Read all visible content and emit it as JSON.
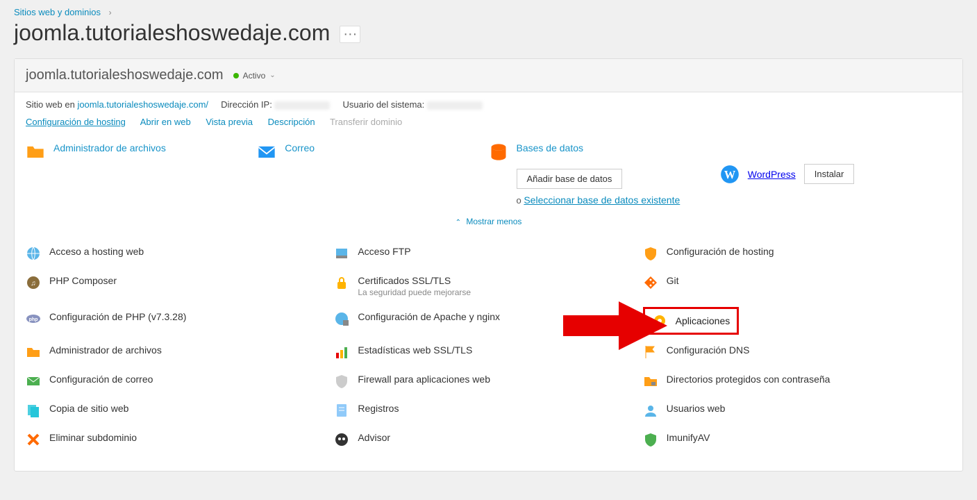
{
  "breadcrumb": {
    "root": "Sitios web y dominios"
  },
  "page_title": "joomla.tutorialeshoswedaje.com",
  "header": {
    "domain": "joomla.tutorialeshoswedaje.com",
    "status": "Activo"
  },
  "info": {
    "site_label": "Sitio web en ",
    "site_link": "joomla.tutorialeshoswedaje.com/",
    "ip_label": "Dirección IP:",
    "user_label": "Usuario del sistema:"
  },
  "links": {
    "hosting_config": "Configuración de hosting",
    "open_web": "Abrir en web",
    "preview": "Vista previa",
    "description": "Descripción",
    "transfer": "Transferir dominio"
  },
  "quick": {
    "file_manager": "Administrador de archivos",
    "mail": "Correo",
    "db": "Bases de datos",
    "db_add": "Añadir base de datos",
    "db_or": "o ",
    "db_select": "Seleccionar base de datos existente",
    "wordpress": "WordPress",
    "install": "Instalar"
  },
  "toggle": "Mostrar menos",
  "grid": [
    {
      "label": "Acceso a hosting web"
    },
    {
      "label": "Acceso FTP"
    },
    {
      "label": "Configuración de hosting"
    },
    {
      "label": "PHP Composer"
    },
    {
      "label": "Certificados SSL/TLS",
      "sub": "La seguridad puede mejorarse"
    },
    {
      "label": "Git"
    },
    {
      "label": "Configuración de PHP (v7.3.28)"
    },
    {
      "label": "Configuración de Apache y nginx"
    },
    {
      "label": "Aplicaciones",
      "highlight": true
    },
    {
      "label": "Administrador de archivos"
    },
    {
      "label": "Estadísticas web SSL/TLS"
    },
    {
      "label": "Configuración DNS"
    },
    {
      "label": "Configuración de correo"
    },
    {
      "label": "Firewall para aplicaciones web"
    },
    {
      "label": "Directorios protegidos con contraseña"
    },
    {
      "label": "Copia de sitio web"
    },
    {
      "label": "Registros"
    },
    {
      "label": "Usuarios web"
    },
    {
      "label": "Eliminar subdominio"
    },
    {
      "label": "Advisor"
    },
    {
      "label": "ImunifyAV"
    }
  ],
  "icons": [
    "globe",
    "ftp",
    "shield",
    "composer",
    "lock",
    "git",
    "php",
    "apache",
    "gear",
    "folder",
    "stats",
    "flag",
    "mail-cfg",
    "firewall",
    "folder-lock",
    "copy",
    "log",
    "users",
    "delete",
    "advisor",
    "imunify"
  ]
}
